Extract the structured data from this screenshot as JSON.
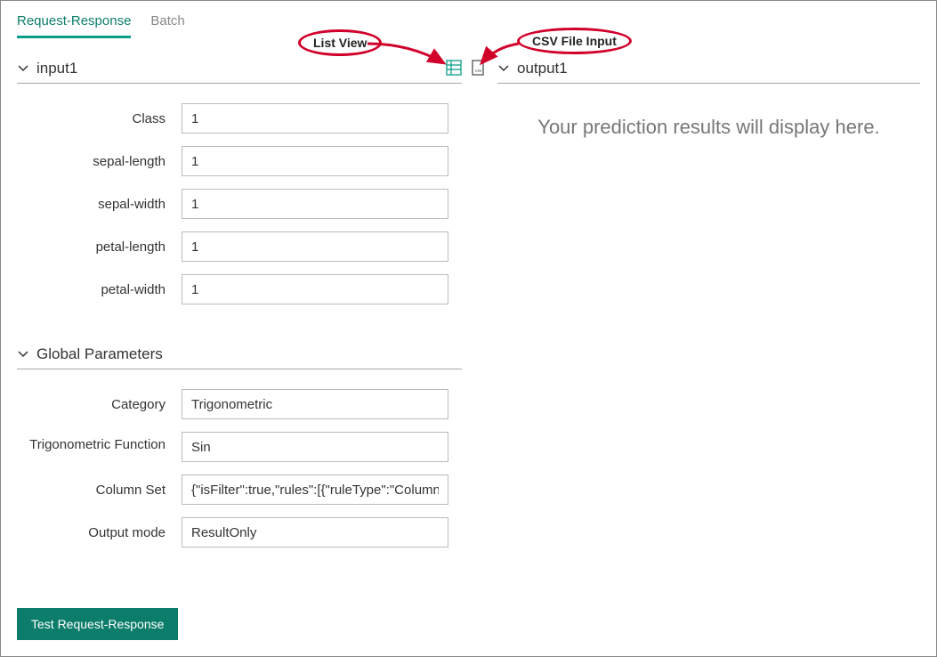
{
  "tabs": {
    "request_response": "Request-Response",
    "batch": "Batch"
  },
  "sections": {
    "input1": {
      "title": "input1",
      "fields": [
        {
          "label": "Class",
          "value": "1"
        },
        {
          "label": "sepal-length",
          "value": "1"
        },
        {
          "label": "sepal-width",
          "value": "1"
        },
        {
          "label": "petal-length",
          "value": "1"
        },
        {
          "label": "petal-width",
          "value": "1"
        }
      ]
    },
    "global_params": {
      "title": "Global Parameters",
      "fields": [
        {
          "label": "Category",
          "value": "Trigonometric"
        },
        {
          "label": "Trigonometric Function",
          "value": "Sin"
        },
        {
          "label": "Column Set",
          "value": "{\"isFilter\":true,\"rules\":[{\"ruleType\":\"ColumnTy"
        },
        {
          "label": "Output mode",
          "value": "ResultOnly"
        }
      ]
    },
    "output1": {
      "title": "output1",
      "placeholder": "Your prediction results will display here."
    }
  },
  "buttons": {
    "test": "Test Request-Response"
  },
  "annotations": {
    "list_view": "List View",
    "csv_file_input": "CSV File Input"
  },
  "icons": {
    "list_view": "list-view-icon",
    "csv_input": "csv-file-icon"
  }
}
